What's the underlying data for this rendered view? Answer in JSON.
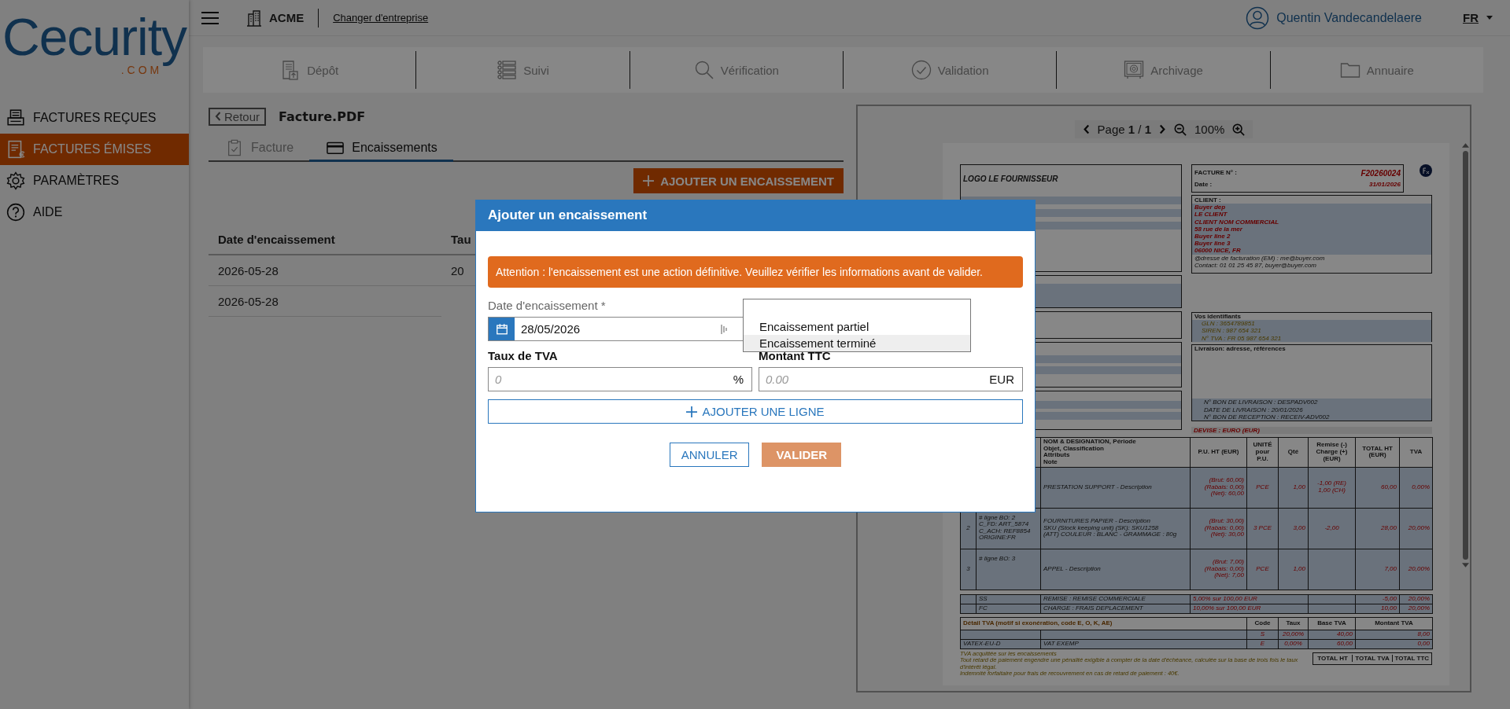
{
  "brand": {
    "name": "Cecurity",
    "suffix": ".COM"
  },
  "sidebar": {
    "items": [
      {
        "label": "FACTURES REÇUES",
        "selected": false
      },
      {
        "label": "FACTURES ÉMISES",
        "selected": true
      },
      {
        "label": "PARAMÈTRES",
        "selected": false
      },
      {
        "label": "AIDE",
        "selected": false
      }
    ]
  },
  "topbar": {
    "company": "ACME",
    "change_company": "Changer d'entreprise",
    "user": "Quentin Vandecandelaere",
    "language": "FR"
  },
  "nav": [
    "Dépôt",
    "Suivi",
    "Vérification",
    "Validation",
    "Archivage",
    "Annuaire"
  ],
  "document": {
    "back": "Retour",
    "title": "Facture.PDF",
    "tabs": [
      {
        "label": "Facture",
        "selected": false
      },
      {
        "label": "Encaissements",
        "selected": true
      }
    ],
    "add_button": "AJOUTER UN ENCAISSEMENT",
    "table": {
      "columns": [
        "Date d'encaissement",
        "Tau"
      ],
      "rows": [
        [
          "2026-05-28",
          "20"
        ],
        [
          "2026-05-28"
        ]
      ]
    }
  },
  "viewer": {
    "page_label": "Page **1** / **1**",
    "zoom": "100%",
    "invoice": {
      "logo": "LOGO LE FOURNISSEUR",
      "number_label": "FACTURE N° :",
      "number": "F20260024",
      "date_label": "Date :",
      "date": "31/01/2026",
      "client_label": "CLIENT :",
      "client_lines": [
        "Buyer dep",
        "LE CLIENT",
        "CLIENT NOM COMMERCIAL",
        "58 rue de la mer",
        "Buyer line 2",
        "Buyer line 3",
        "06000 NICE, FR"
      ],
      "client_billing": "@dresse de facturation (EM) : me@buyer.com",
      "client_contact": "Contact: 01 01 25 45 87, buyer@buyer.com",
      "ids_label": "Vos identifiants",
      "ids": [
        "GLN : 3654789851",
        "SIREN : 987 654 321",
        "N° TVA : FR 05 987 654 321"
      ],
      "delivery_label": "Livraison: adresse, références",
      "delivery": [
        "N° BON DE LIVRAISON : DESPADV002",
        "DATE DE LIVRAISON : 20/01/2026",
        "N° BON DE RECEPTION : RECEIV-ADV002"
      ],
      "currency": "DEVISE : EURO (EUR)",
      "line_columns": [
        "NOM & DESIGNATION, Période\nObjet, Classification\nAttributs\nNote",
        "P.U. HT (EUR)",
        "UNITÉ pour P.U.",
        "Qté",
        "Remise (-)\nCharge (+)\n(EUR)",
        "TOTAL HT (EUR)",
        "TVA"
      ],
      "lines": [
        {
          "designation": "PRESTATION SUPPORT - Description",
          "price": "(Brut: 60,00)\n(Rabais: 0,00)\n(Net): 60,00",
          "unit": "PCE",
          "qty": "1,00",
          "adjust": "-1,00 (RE)\n1,00 (CH)",
          "total": "60,00",
          "vat": "0,00%"
        },
        {
          "num": "2",
          "ref": "# ligne BO: 2\nC_FD: ART_5874\nC_ACH: REF8854\nORIGINE:FR",
          "designation": "FOURNITURES PAPIER - Description\nSKU (Stock keeping unit) (SK): SKU1258\n(ATT) COULEUR : BLANC - GRAMMAGE : 80g",
          "price": "(Brut: 30,00)\n(Rabais: 0,00)\n(Net): 30,00",
          "unit": "3 PCE",
          "qty": "3,00",
          "adjust": "-2,00",
          "total": "28,00",
          "vat": "20,00%"
        },
        {
          "num": "3",
          "ref": "# ligne BO: 3",
          "designation": "APPEL - Description",
          "price": "(Brut: 7,00)\n(Rabais: 0,00)\n(Net): 7,00",
          "unit": "PCE",
          "qty": "1,00",
          "total": "7,00",
          "vat": "20,00%"
        }
      ],
      "allowances": [
        {
          "code": "SS",
          "label": "REMISE : REMISE COMMERCIALE",
          "basis": "5,00% sur 100,00 EUR",
          "amount": "-5,00",
          "vat": "20,00%"
        },
        {
          "code": "FC",
          "label": "CHARGE : FRAIS DEPLACEMENT",
          "basis": "10,00% sur 100,00 EUR",
          "amount": "10,00",
          "vat": "20,00%"
        }
      ],
      "vat_title": "Détail TVA (motif si exonération, code E, O, K, AE)",
      "vat_columns": [
        "Code",
        "Taux",
        "Base TVA",
        "Montant TVA"
      ],
      "vat_rows": [
        {
          "code": "S",
          "rate": "20,00%",
          "base": "40,00",
          "amount": "8,00"
        },
        {
          "reason_code": "VATEX-EU-D",
          "reason": "VAT EXEMP",
          "code": "E",
          "rate": "0,00%",
          "base": "60,00",
          "amount": "0,00"
        }
      ],
      "notes": [
        "TVA acquittée sur les encaissements",
        "Tout retard de paiement engendre une pénalité exigible à compter de la date d'échéance, calculée sur la base de trois fois le taux d'intérêt légal.",
        "Indemnité forfaitaire pour frais de recouvrement en cas de retard de paiement : 40€."
      ],
      "totals_columns": [
        "TOTAL HT",
        "TOTAL TVA",
        "TOTAL TTC"
      ]
    }
  },
  "modal": {
    "title": "Ajouter un encaissement",
    "warning": "Attention : l'encaissement est une action définitive. Veuillez vérifier les informations avant de valider.",
    "date_label": "Date d'encaissement *",
    "date_value": "28/05/2026",
    "type_options": [
      {
        "label": "Encaissement partiel",
        "selected": false
      },
      {
        "label": "Encaissement terminé",
        "selected": true
      }
    ],
    "vat_label": "Taux de TVA",
    "vat_placeholder": "0",
    "vat_unit": "%",
    "amount_label": "Montant TTC",
    "amount_placeholder": "0.00",
    "amount_unit": "EUR",
    "add_line": "AJOUTER UNE LIGNE",
    "cancel": "ANNULER",
    "confirm": "VALIDER",
    "confirm_disabled": true
  }
}
